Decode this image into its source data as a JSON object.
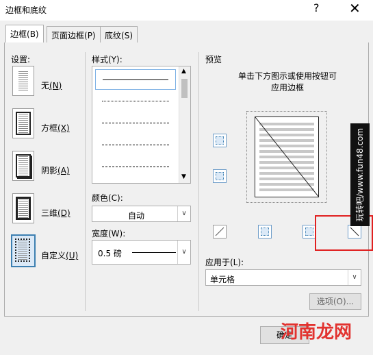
{
  "window": {
    "title": "边框和底纹",
    "help": "?",
    "close": "✕"
  },
  "tabs": [
    {
      "label": "边框",
      "key": "(B)",
      "active": true
    },
    {
      "label": "页面边框",
      "key": "(P)",
      "active": false
    },
    {
      "label": "底纹",
      "key": "(S)",
      "active": false
    }
  ],
  "settings": {
    "heading": "设置:",
    "items": [
      {
        "label": "无",
        "key": "(N)"
      },
      {
        "label": "方框",
        "key": "(X)"
      },
      {
        "label": "阴影",
        "key": "(A)"
      },
      {
        "label": "三维",
        "key": "(D)"
      },
      {
        "label": "自定义",
        "key": "(U)",
        "selected": true
      }
    ]
  },
  "style": {
    "heading": "样式(Y):",
    "lines": [
      "solid",
      "dotted",
      "dashed-small",
      "dashed",
      "dash-dot"
    ]
  },
  "color": {
    "heading": "颜色(C):",
    "value": "自动"
  },
  "width": {
    "heading": "宽度(W):",
    "value": "0.5 磅"
  },
  "preview": {
    "heading": "预览",
    "hint_line1": "单击下方图示或使用按钮可",
    "hint_line2": "应用边框"
  },
  "apply_to": {
    "heading": "应用于(L):",
    "value": "单元格"
  },
  "options_button": "选项(O)...",
  "ok_button": "确定",
  "watermark": {
    "side_text": "玩转吧/www.fun48.com",
    "logo_text": "河南龙网"
  },
  "colors": {
    "accent": "#3c7fb1",
    "highlight": "#e02020"
  }
}
